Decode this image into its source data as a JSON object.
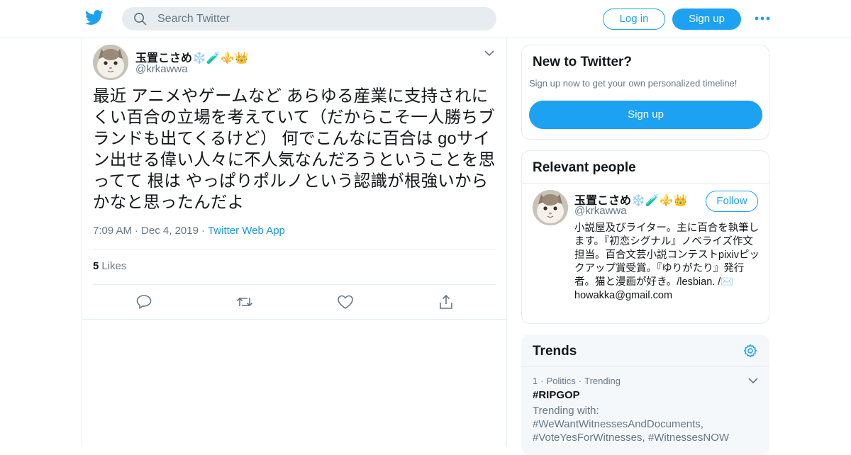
{
  "header": {
    "search_placeholder": "Search Twitter",
    "login_label": "Log in",
    "signup_label": "Sign up"
  },
  "tweet": {
    "author_name": "玉置こさめ❄️🧪⚜️👑",
    "author_handle": "@krkawwa",
    "text": "最近 アニメやゲームなど あらゆる産業に支持されにくい百合の立場を考えていて（だからこそ一人勝ちブランドも出てくるけど） 何でこんなに百合は goサイン出せる偉い人々に不人気なんだろうということを思ってて 根は やっぱりポルノという認識が根強いからかなと思ったんだよ",
    "time": "7:09 AM",
    "date": "Dec 4, 2019",
    "source": "Twitter Web App",
    "like_count": "5",
    "like_label": "Likes"
  },
  "sidebar": {
    "new_title": "New to Twitter?",
    "new_subtitle": "Sign up now to get your own personalized timeline!",
    "new_signup_label": "Sign up",
    "relevant_title": "Relevant people",
    "person": {
      "name": "玉置こさめ❄️🧪⚜️👑",
      "handle": "@krkawwa",
      "follow_label": "Follow",
      "bio": "小説屋及びライター。主に百合を執筆します。『初恋シグナル』ノベライズ作文担当。百合文芸小説コンテストpixivピックアップ賞受賞。『ゆりがたり』発行者。猫と漫画が好き。/lesbian. /✉️ howakka@gmail.com"
    },
    "trends_title": "Trends",
    "trend": {
      "rank": "1",
      "category": "Politics",
      "status": "Trending",
      "name": "#RIPGOP",
      "with": "Trending with: #WeWantWitnessesAndDocuments, #VoteYesForWitnesses, #WitnessesNOW"
    }
  },
  "colors": {
    "brand": "#1da1f2",
    "text": "#14171a",
    "secondary_text": "#657786",
    "border": "#e6ecf0",
    "trends_bg": "#f5f8fa"
  },
  "icons": [
    "twitter-bird-icon",
    "search-icon",
    "more-dots-icon",
    "chevron-down-icon",
    "reply-icon",
    "retweet-icon",
    "like-heart-icon",
    "share-icon",
    "gear-icon"
  ]
}
